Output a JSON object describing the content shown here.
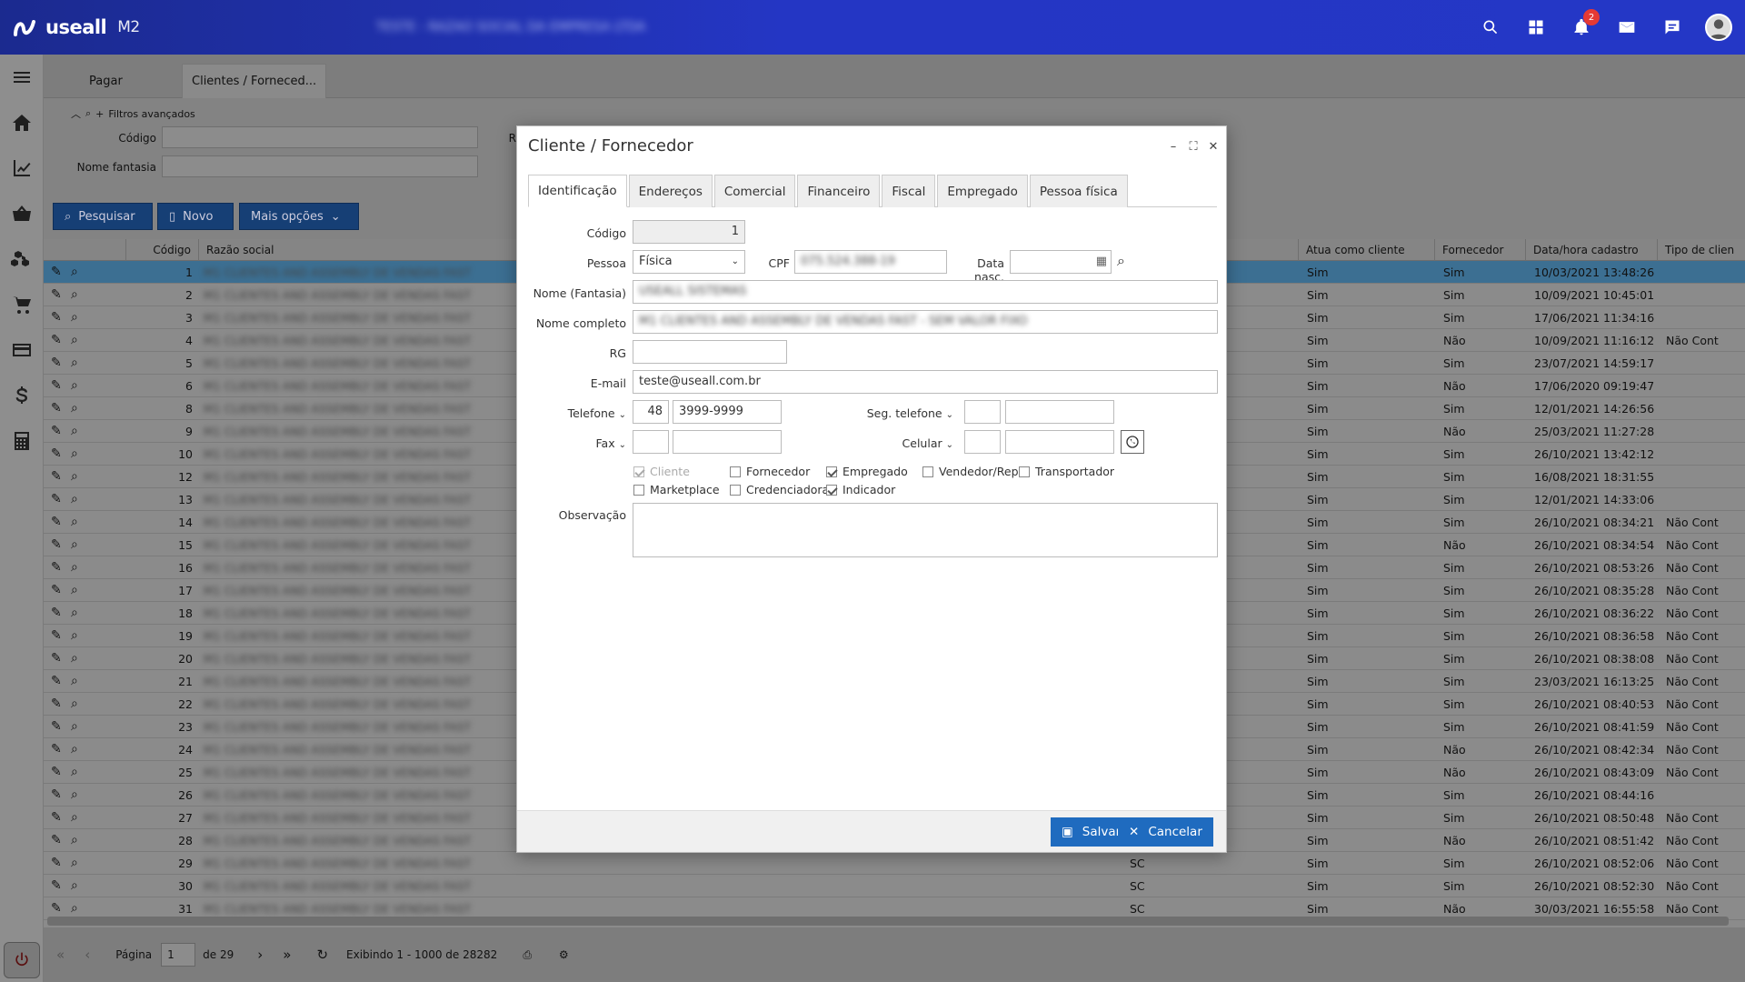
{
  "app": {
    "brand": "useall",
    "version": "M2",
    "company": "TESTE - RAZAO SOCIAL DA EMPRESA LTDA",
    "notifications_count": "2"
  },
  "sidebar": {
    "items": [
      "menu",
      "home",
      "dashboard",
      "basket",
      "inventory",
      "cart",
      "card",
      "finance",
      "calculator"
    ]
  },
  "page_tabs": [
    {
      "label": "Pagar"
    },
    {
      "label": "Clientes / Forneced..."
    }
  ],
  "filters": {
    "toggle_label": "Filtros avançados",
    "codigo_label": "Código",
    "nome_fantasia_label": "Nome fantasia",
    "r_label": "R"
  },
  "toolbar": {
    "pesquisar": "Pesquisar",
    "novo": "Novo",
    "mais_opcoes": "Mais opções"
  },
  "grid": {
    "headers": [
      "Código",
      "Razão social",
      "Atua como cliente",
      "Fornecedor",
      "Data/hora cadastro",
      "Tipo de clien"
    ],
    "rows": [
      {
        "codigo": "1",
        "cliente": "Sim",
        "fornecedor": "Sim",
        "data": "10/03/2021 13:48:26",
        "tipo": "",
        "sel": true
      },
      {
        "codigo": "2",
        "cliente": "Sim",
        "fornecedor": "Sim",
        "data": "10/09/2021 10:45:01",
        "tipo": ""
      },
      {
        "codigo": "3",
        "cliente": "Sim",
        "fornecedor": "Sim",
        "data": "17/06/2021 11:34:16",
        "tipo": ""
      },
      {
        "codigo": "4",
        "cliente": "Sim",
        "fornecedor": "Não",
        "data": "10/09/2021 11:16:12",
        "tipo": "Não Cont"
      },
      {
        "codigo": "5",
        "cliente": "Sim",
        "fornecedor": "Sim",
        "data": "23/07/2021 14:59:17",
        "tipo": ""
      },
      {
        "codigo": "6",
        "cliente": "Sim",
        "fornecedor": "Não",
        "data": "17/06/2020 09:19:47",
        "tipo": ""
      },
      {
        "codigo": "8",
        "cliente": "Sim",
        "fornecedor": "Sim",
        "data": "12/01/2021 14:26:56",
        "tipo": ""
      },
      {
        "codigo": "9",
        "cliente": "Sim",
        "fornecedor": "Não",
        "data": "25/03/2021 11:27:28",
        "tipo": ""
      },
      {
        "codigo": "10",
        "cliente": "Sim",
        "fornecedor": "Sim",
        "data": "26/10/2021 13:42:12",
        "tipo": ""
      },
      {
        "codigo": "12",
        "cliente": "Sim",
        "fornecedor": "Sim",
        "data": "16/08/2021 18:31:55",
        "tipo": ""
      },
      {
        "codigo": "13",
        "cliente": "Sim",
        "fornecedor": "Sim",
        "data": "12/01/2021 14:33:06",
        "tipo": ""
      },
      {
        "codigo": "14",
        "cliente": "Sim",
        "fornecedor": "Sim",
        "data": "26/10/2021 08:34:21",
        "tipo": "Não Cont"
      },
      {
        "codigo": "15",
        "cliente": "Sim",
        "fornecedor": "Não",
        "data": "26/10/2021 08:34:54",
        "tipo": "Não Cont"
      },
      {
        "codigo": "16",
        "cliente": "Sim",
        "fornecedor": "Sim",
        "data": "26/10/2021 08:53:26",
        "tipo": "Não Cont"
      },
      {
        "codigo": "17",
        "cliente": "Sim",
        "fornecedor": "Sim",
        "data": "26/10/2021 08:35:28",
        "tipo": "Não Cont"
      },
      {
        "codigo": "18",
        "cliente": "Sim",
        "fornecedor": "Sim",
        "data": "26/10/2021 08:36:22",
        "tipo": "Não Cont"
      },
      {
        "codigo": "19",
        "cliente": "Sim",
        "fornecedor": "Sim",
        "data": "26/10/2021 08:36:58",
        "tipo": "Não Cont"
      },
      {
        "codigo": "20",
        "cliente": "Sim",
        "fornecedor": "Sim",
        "data": "26/10/2021 08:38:08",
        "tipo": "Não Cont"
      },
      {
        "codigo": "21",
        "cliente": "Sim",
        "fornecedor": "Sim",
        "data": "23/03/2021 16:13:25",
        "tipo": "Não Cont"
      },
      {
        "codigo": "22",
        "cliente": "Sim",
        "fornecedor": "Sim",
        "data": "26/10/2021 08:40:53",
        "tipo": "Não Cont"
      },
      {
        "codigo": "23",
        "cliente": "Sim",
        "fornecedor": "Sim",
        "data": "26/10/2021 08:41:59",
        "tipo": "Não Cont"
      },
      {
        "codigo": "24",
        "cliente": "Sim",
        "fornecedor": "Não",
        "data": "26/10/2021 08:42:34",
        "tipo": "Não Cont"
      },
      {
        "codigo": "25",
        "cliente": "Sim",
        "fornecedor": "Não",
        "data": "26/10/2021 08:43:09",
        "tipo": "Não Cont"
      },
      {
        "codigo": "26",
        "cliente": "Sim",
        "fornecedor": "Sim",
        "data": "26/10/2021 08:44:16",
        "tipo": ""
      },
      {
        "codigo": "27",
        "cliente": "Sim",
        "fornecedor": "Sim",
        "data": "26/10/2021 08:50:48",
        "tipo": "Não Cont"
      },
      {
        "codigo": "28",
        "cliente": "Sim",
        "fornecedor": "Não",
        "data": "26/10/2021 08:51:42",
        "tipo": "Não Cont"
      },
      {
        "codigo": "29",
        "uf": "SC",
        "cliente": "Sim",
        "fornecedor": "Sim",
        "data": "26/10/2021 08:52:06",
        "tipo": "Não Cont"
      },
      {
        "codigo": "30",
        "uf": "SC",
        "cliente": "Sim",
        "fornecedor": "Sim",
        "data": "26/10/2021 08:52:30",
        "tipo": "Não Cont"
      },
      {
        "codigo": "31",
        "uf": "SC",
        "cliente": "Sim",
        "fornecedor": "Não",
        "data": "30/03/2021 16:55:58",
        "tipo": "Não Cont"
      }
    ]
  },
  "pager": {
    "page_label": "Página",
    "page": "1",
    "of": "de 29",
    "showing": "Exibindo 1 - 1000 de 28282"
  },
  "modal": {
    "title": "Cliente / Fornecedor",
    "tabs": [
      "Identificação",
      "Endereços",
      "Comercial",
      "Financeiro",
      "Fiscal",
      "Empregado",
      "Pessoa física"
    ],
    "labels": {
      "codigo": "Código",
      "pessoa": "Pessoa",
      "cpf": "CPF",
      "data_nasc": "Data nasc.",
      "nome_fantasia": "Nome (Fantasia)",
      "nome_completo": "Nome completo",
      "rg": "RG",
      "email": "E-mail",
      "telefone": "Telefone",
      "seg_telefone": "Seg. telefone",
      "fax": "Fax",
      "celular": "Celular",
      "observacao": "Observação"
    },
    "values": {
      "codigo": "1",
      "pessoa": "Física",
      "cpf": "075.524.388-19",
      "nome_fantasia": "USEALL SISTEMAS",
      "nome_completo": "M1 CLIENTES AND ASSEMBLY DE VENDAS FAST - SEM VALOR FIXO",
      "email": "teste@useall.com.br",
      "telefone_ddd": "48",
      "telefone": "3999-9999"
    },
    "checkboxes": [
      {
        "label": "Cliente",
        "checked": true,
        "disabled": true
      },
      {
        "label": "Fornecedor",
        "checked": false
      },
      {
        "label": "Empregado",
        "checked": true
      },
      {
        "label": "Vendedor/Repr.",
        "checked": false
      },
      {
        "label": "Transportador",
        "checked": false
      },
      {
        "label": "Marketplace",
        "checked": false
      },
      {
        "label": "Credenciadora",
        "checked": false
      },
      {
        "label": "Indicador",
        "checked": true
      }
    ],
    "buttons": {
      "salvar": "Salvar",
      "cancelar": "Cancelar"
    }
  },
  "colors": {
    "topbar": "#2436c4",
    "primary_button": "#1f6bbf",
    "selected_row": "#3c6f92"
  }
}
